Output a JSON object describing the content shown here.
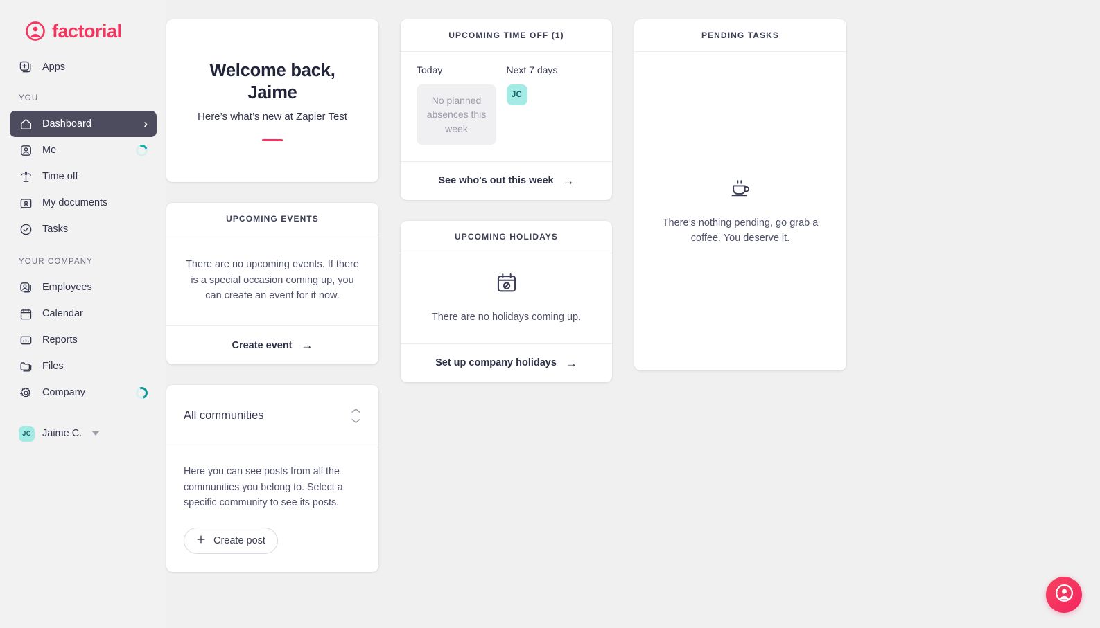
{
  "brand": {
    "name": "factorial",
    "color": "#f5355f",
    "logo_icon": "factorial-avatar-logo-icon"
  },
  "sidebar": {
    "apps": {
      "label": "Apps",
      "icon": "apps-plus-icon"
    },
    "sections": [
      {
        "label": "YOU",
        "items": [
          {
            "label": "Dashboard",
            "icon": "home-icon",
            "active": true,
            "chevron": "›"
          },
          {
            "label": "Me",
            "icon": "user-square-icon",
            "loading": true
          },
          {
            "label": "Time off",
            "icon": "palm-tree-icon"
          },
          {
            "label": "My documents",
            "icon": "folder-user-icon"
          },
          {
            "label": "Tasks",
            "icon": "check-circle-icon"
          }
        ]
      },
      {
        "label": "YOUR COMPANY",
        "items": [
          {
            "label": "Employees",
            "icon": "users-icon"
          },
          {
            "label": "Calendar",
            "icon": "calendar-icon"
          },
          {
            "label": "Reports",
            "icon": "bar-chart-icon"
          },
          {
            "label": "Files",
            "icon": "folder-icon"
          },
          {
            "label": "Company",
            "icon": "gear-icon",
            "loading": true
          }
        ]
      }
    ],
    "user": {
      "initials": "JC",
      "name": "Jaime C.",
      "caret": "chevron-down-icon"
    }
  },
  "welcome": {
    "title": "Welcome back,\nJaime",
    "title_line1": "Welcome back,",
    "title_line2": "Jaime",
    "subtitle": "Here’s what’s new at Zapier Test"
  },
  "time_off": {
    "header": "UPCOMING TIME OFF (1)",
    "today_label": "Today",
    "today_empty": "No planned absences this week",
    "next_label": "Next 7 days",
    "next_avatars": [
      {
        "initials": "JC"
      }
    ],
    "footer": "See who's out this week",
    "footer_arrow": "→"
  },
  "upcoming_events": {
    "header": "UPCOMING EVENTS",
    "body": "There are no upcoming events. If there is a special occasion coming up, you can create an event for it now.",
    "footer": "Create event",
    "footer_arrow": "→"
  },
  "upcoming_holidays": {
    "header": "UPCOMING HOLIDAYS",
    "icon": "calendar-blocked-icon",
    "body": "There are no holidays coming up.",
    "footer": "Set up company holidays",
    "footer_arrow": "→"
  },
  "pending_tasks": {
    "header": "PENDING TASKS",
    "icon": "coffee-cup-icon",
    "body": "There’s nothing pending, go grab a coffee. You deserve it."
  },
  "communities": {
    "title": "All communities",
    "selector_icon": "chevron-up-down-icon",
    "body": "Here you can see posts from all the communities you belong to. Select a specific community to see its posts.",
    "create_post": "Create post",
    "create_post_icon": "plus-icon"
  },
  "fab": {
    "icon": "factorial-avatar-logo-icon",
    "color": "#f5355f"
  }
}
